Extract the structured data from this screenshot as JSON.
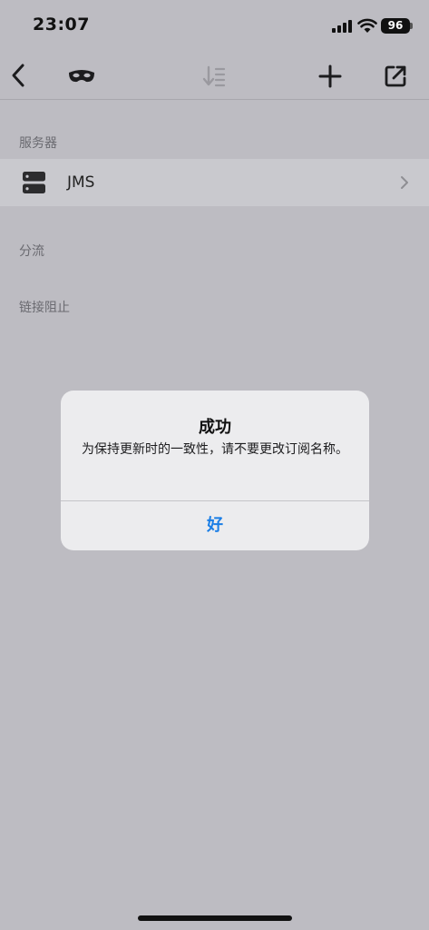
{
  "status_bar": {
    "time": "23:07",
    "battery": "96",
    "icons": [
      "cellular-signal-icon",
      "wifi-icon",
      "battery-icon"
    ]
  },
  "nav_bar": {
    "icons": [
      "chevron-left-icon",
      "mask-icon",
      "sort-icon",
      "plus-icon",
      "share-icon"
    ]
  },
  "sections": {
    "servers": "服务器",
    "routing": "分流",
    "block": "链接阻止"
  },
  "server_row": {
    "name": "JMS",
    "icon": "server-icon"
  },
  "alert": {
    "title": "成功",
    "message": "为保持更新时的一致性，请不要更改订阅名称。",
    "button": "好"
  },
  "colors": {
    "accent": "#1a7ee6",
    "background": "#bdbcc2",
    "alert_background": "#ececee"
  }
}
